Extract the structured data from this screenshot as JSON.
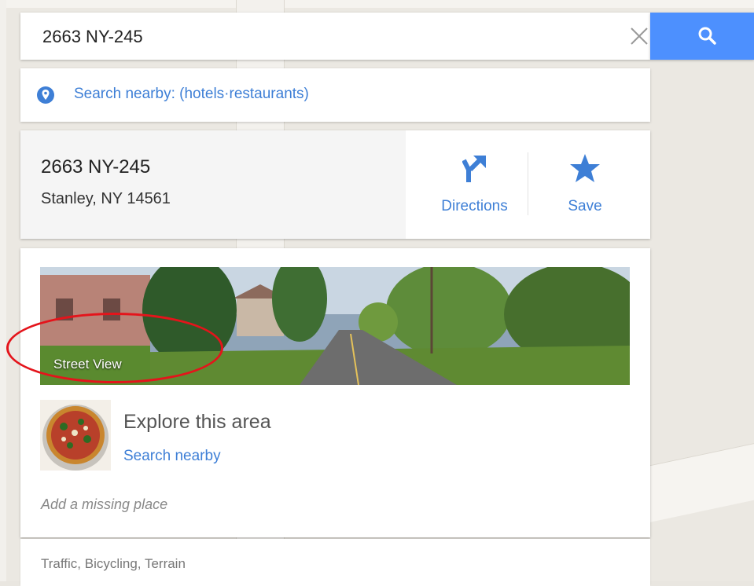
{
  "search": {
    "value": "2663 NY-245"
  },
  "nearby": {
    "label": "Search nearby: (hotels·restaurants)"
  },
  "place": {
    "title": "2663 NY-245",
    "address": "Stanley, NY 14561",
    "directions_label": "Directions",
    "save_label": "Save"
  },
  "street_view": {
    "label": "Street View"
  },
  "explore": {
    "title": "Explore this area",
    "link": "Search nearby"
  },
  "missing_place": "Add a missing place",
  "layers": "Traffic, Bicycling, Terrain",
  "colors": {
    "accent": "#4d90fe",
    "link": "#3e7fd6",
    "annotation": "#e4141b"
  }
}
